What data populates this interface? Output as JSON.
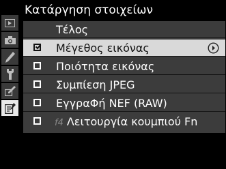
{
  "title": "Κατάργηση στοιχείων",
  "menu": {
    "done_label": "Τέλος",
    "items": [
      {
        "label": "Μέγεθος εικόνας",
        "checked": true
      },
      {
        "label": "Ποιότητα εικόνας",
        "checked": false
      },
      {
        "label": "Συμπίεση JPEG",
        "checked": false
      },
      {
        "label": "ΕγγραΦή NEF (RAW)",
        "checked": false
      },
      {
        "prefix": "f4",
        "label": "Λειτουργία κουμπιού Fn",
        "checked": false
      }
    ]
  },
  "sidebar": {
    "tabs": [
      "playback-icon",
      "camera-icon",
      "pencil-icon",
      "wrench-icon",
      "retouch-icon",
      "my-menu-icon"
    ],
    "active": "my-menu-icon"
  },
  "colors": {
    "background": "#000000",
    "menu_panel": "#3c3c3c",
    "selected_row": "#d9d9d9",
    "tab_inactive": "#3a3a3a",
    "tab_active": "#e8e8e8"
  }
}
